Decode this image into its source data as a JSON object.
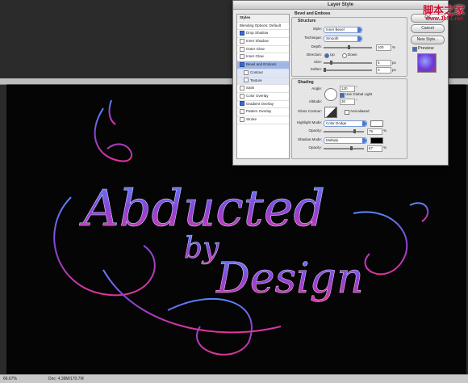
{
  "watermark": {
    "cn": "脚本之家",
    "url": "www.Jb51.net"
  },
  "dialog": {
    "title": "Layer Style",
    "styles_header": "Styles",
    "blending": "Blending Options: Default",
    "styles": [
      {
        "label": "Drop Shadow",
        "on": true
      },
      {
        "label": "Inner Shadow",
        "on": false
      },
      {
        "label": "Outer Glow",
        "on": false
      },
      {
        "label": "Inner Glow",
        "on": false
      },
      {
        "label": "Bevel and Emboss",
        "on": true
      },
      {
        "label": "Contour",
        "on": false
      },
      {
        "label": "Texture",
        "on": false
      },
      {
        "label": "Satin",
        "on": false
      },
      {
        "label": "Color Overlay",
        "on": false
      },
      {
        "label": "Gradient Overlay",
        "on": true
      },
      {
        "label": "Pattern Overlay",
        "on": false
      },
      {
        "label": "Stroke",
        "on": false
      }
    ],
    "bevel_title": "Bevel and Emboss",
    "structure_title": "Structure",
    "style_label": "Style:",
    "style_value": "Inner Bevel",
    "technique_label": "Technique:",
    "technique_value": "Smooth",
    "depth_label": "Depth:",
    "depth_value": "100",
    "depth_unit": "%",
    "direction_label": "Direction:",
    "dir_up": "Up",
    "dir_down": "Down",
    "size_label": "Size:",
    "size_value": "6",
    "size_unit": "px",
    "soften_label": "Soften:",
    "soften_value": "0",
    "soften_unit": "px",
    "shading_title": "Shading",
    "angle_label": "Angle:",
    "angle_value": "120",
    "angle_unit": "°",
    "global_light": "Use Global Light",
    "altitude_label": "Altitude:",
    "altitude_value": "30",
    "altitude_unit": "°",
    "gloss_label": "Gloss Contour:",
    "anti_aliased": "Anti-aliased",
    "highlight_label": "Highlight Mode:",
    "highlight_value": "Color Dodge",
    "opacity_label": "Opacity:",
    "hl_opacity": "75",
    "pct": "%",
    "shadow_label": "Shadow Mode:",
    "shadow_value": "Multiply",
    "sh_opacity": "67",
    "ok": "OK",
    "cancel": "Cancel",
    "new_style": "New Style...",
    "preview": "Preview"
  },
  "status": {
    "zoom": "66.67%",
    "doc": "Doc: 4.39M/170.7M"
  },
  "art": {
    "line1": "Abducted",
    "line2": "by",
    "line3": "Design"
  },
  "colors": {
    "blue": "#4f6ff0",
    "purple": "#8b3ad8",
    "pink": "#e0339f"
  }
}
